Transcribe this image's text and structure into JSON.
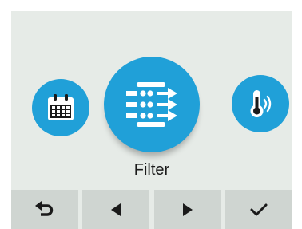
{
  "screen": {
    "mode_label": "Filter",
    "accent_color": "#20a0d8"
  },
  "menu": {
    "items": [
      {
        "name": "calendar",
        "icon": "calendar-icon"
      },
      {
        "name": "filter",
        "icon": "filter-icon",
        "selected": true
      },
      {
        "name": "temperature",
        "icon": "thermometer-icon"
      }
    ]
  },
  "softkeys": [
    {
      "name": "back",
      "icon": "return-arrow-icon"
    },
    {
      "name": "previous",
      "icon": "triangle-left-icon"
    },
    {
      "name": "next",
      "icon": "triangle-right-icon"
    },
    {
      "name": "confirm",
      "icon": "checkmark-icon"
    }
  ]
}
